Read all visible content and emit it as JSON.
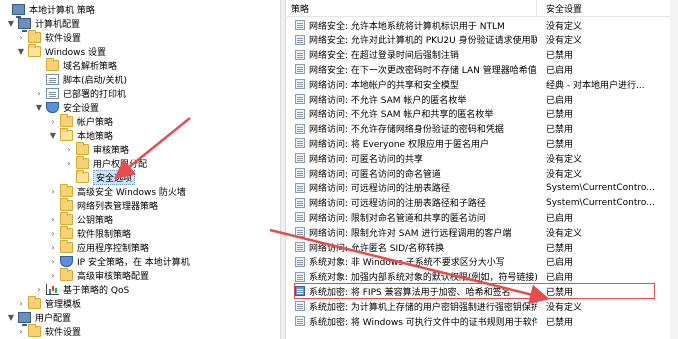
{
  "tree": [
    {
      "label": "本地计算机 策略",
      "icon": "computer-icon",
      "expander": ""
    },
    {
      "label": "计算机配置",
      "icon": "computer-icon",
      "expander": "▼"
    },
    {
      "label": "软件设置",
      "icon": "folder-icon",
      "expander": "›"
    },
    {
      "label": "Windows 设置",
      "icon": "folder-open-icon",
      "expander": "▼"
    },
    {
      "label": "域名解析策略",
      "icon": "folder-icon",
      "expander": ""
    },
    {
      "label": "脚本(启动/关机)",
      "icon": "document-icon",
      "expander": ""
    },
    {
      "label": "已部署的打印机",
      "icon": "printer-icon",
      "expander": "›"
    },
    {
      "label": "安全设置",
      "icon": "shield-icon",
      "expander": "▼"
    },
    {
      "label": "帐户策略",
      "icon": "folder-icon",
      "expander": "›"
    },
    {
      "label": "本地策略",
      "icon": "folder-open-icon",
      "expander": "▼"
    },
    {
      "label": "审核策略",
      "icon": "folder-icon",
      "expander": "›"
    },
    {
      "label": "用户权限分配",
      "icon": "folder-icon",
      "expander": "›"
    },
    {
      "label": "安全选项",
      "icon": "folder-open-icon",
      "expander": "",
      "selected": true
    },
    {
      "label": "高级安全 Windows 防火墙",
      "icon": "folder-icon",
      "expander": "›"
    },
    {
      "label": "网络列表管理器策略",
      "icon": "folder-icon",
      "expander": ""
    },
    {
      "label": "公钥策略",
      "icon": "folder-icon",
      "expander": "›"
    },
    {
      "label": "软件限制策略",
      "icon": "folder-icon",
      "expander": "›"
    },
    {
      "label": "应用程序控制策略",
      "icon": "folder-icon",
      "expander": "›"
    },
    {
      "label": "IP 安全策略，在 本地计算机",
      "icon": "shield-icon",
      "expander": "›"
    },
    {
      "label": "高级审核策略配置",
      "icon": "folder-icon",
      "expander": "›"
    },
    {
      "label": "基于策略的 QoS",
      "icon": "chart-icon",
      "expander": "›"
    },
    {
      "label": "管理模板",
      "icon": "folder-icon",
      "expander": "›"
    },
    {
      "label": "用户配置",
      "icon": "computer-icon",
      "expander": "▼"
    },
    {
      "label": "软件设置",
      "icon": "folder-icon",
      "expander": "›"
    }
  ],
  "columns": {
    "policy": "策略",
    "setting": "安全设置"
  },
  "rows": [
    {
      "policy": "网络安全: 允许本地系统将计算机标识用于 NTLM",
      "setting": "没有定义"
    },
    {
      "policy": "网络安全: 允许对此计算机的 PKU2U 身份验证请求使用联...",
      "setting": "没有定义"
    },
    {
      "policy": "网络安全: 在超过登录时间后强制注销",
      "setting": "已禁用"
    },
    {
      "policy": "网络安全: 在下一次更改密码时不存储 LAN 管理器哈希值",
      "setting": "已启用"
    },
    {
      "policy": "网络访问: 本地帐户的共享和安全模型",
      "setting": "经典 - 对本地用户进行..."
    },
    {
      "policy": "网络访问: 不允许 SAM 帐户的匿名枚举",
      "setting": "已启用"
    },
    {
      "policy": "网络访问: 不允许 SAM 帐户和共享的匿名枚举",
      "setting": "已禁用"
    },
    {
      "policy": "网络访问: 不允许存储网络身份验证的密码和凭据",
      "setting": "已禁用"
    },
    {
      "policy": "网络访问: 将 Everyone 权限应用于匿名用户",
      "setting": "已禁用"
    },
    {
      "policy": "网络访问: 可匿名访问的共享",
      "setting": "没有定义"
    },
    {
      "policy": "网络访问: 可匿名访问的命名管道",
      "setting": "没有定义"
    },
    {
      "policy": "网络访问: 可远程访问的注册表路径",
      "setting": "System\\CurrentContro..."
    },
    {
      "policy": "网络访问: 可远程访问的注册表路径和子路径",
      "setting": "System\\CurrentContro..."
    },
    {
      "policy": "网络访问: 限制对命名管道和共享的匿名访问",
      "setting": "已启用"
    },
    {
      "policy": "网络访问: 限制允许对 SAM 进行远程调用的客户端",
      "setting": "没有定义"
    },
    {
      "policy": "网络访问: 允许匿名 SID/名称转换",
      "setting": "已禁用"
    },
    {
      "policy": "系统对象: 非 Windows 子系统不要求区分大小写",
      "setting": "已启用"
    },
    {
      "policy": "系统对象: 加强内部系统对象的默认权限(例如，符号链接)",
      "setting": "已启用"
    },
    {
      "policy": "系统加密: 将 FIPS 兼容算法用于加密、哈希和签名",
      "setting": "已禁用",
      "highlight": true
    },
    {
      "policy": "系统加密: 为计算机上存储的用户密钥强制进行强密钥保护",
      "setting": "没有定义"
    },
    {
      "policy": "系统加密: 将 Windows 可执行文件中的证书规则用于软件限...",
      "setting": "已禁用"
    }
  ],
  "colors": {
    "annotation": "#e84d4d",
    "selection": "#cce4f7"
  }
}
